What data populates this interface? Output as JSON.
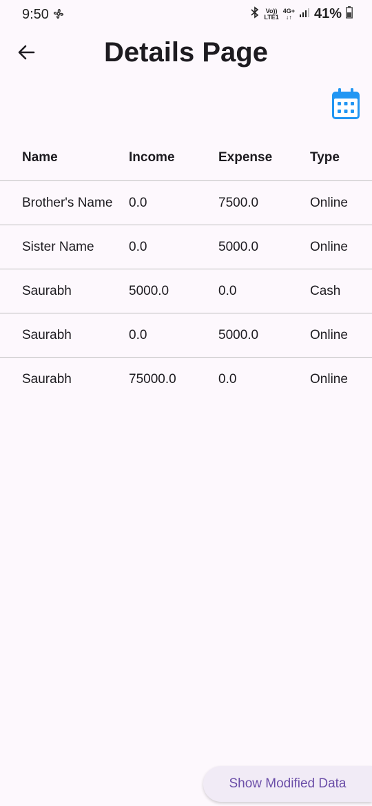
{
  "status_bar": {
    "time": "9:50",
    "network_top": "Vo))",
    "network_bottom": "LTE1",
    "gen_label": "4G+",
    "battery": "41%",
    "icons": [
      "fan-icon",
      "bluetooth-icon",
      "signal-icon",
      "battery-icon"
    ]
  },
  "app_bar": {
    "title": "Details Page",
    "back_icon": "arrow-left-icon"
  },
  "calendar": {
    "icon": "calendar-icon",
    "color": "#2196f3"
  },
  "table": {
    "columns": [
      "Name",
      "Income",
      "Expense",
      "Type"
    ],
    "rows": [
      {
        "name": "Brother's Name",
        "income": "0.0",
        "expense": "7500.0",
        "type": "Online"
      },
      {
        "name": "Sister Name",
        "income": "0.0",
        "expense": "5000.0",
        "type": "Online"
      },
      {
        "name": "Saurabh",
        "income": "5000.0",
        "expense": "0.0",
        "type": "Cash"
      },
      {
        "name": "Saurabh",
        "income": "0.0",
        "expense": "5000.0",
        "type": "Online"
      },
      {
        "name": "Saurabh",
        "income": "75000.0",
        "expense": "0.0",
        "type": "Online"
      }
    ]
  },
  "action": {
    "label": "Show Modified Data",
    "color": "#6b4ea8"
  }
}
